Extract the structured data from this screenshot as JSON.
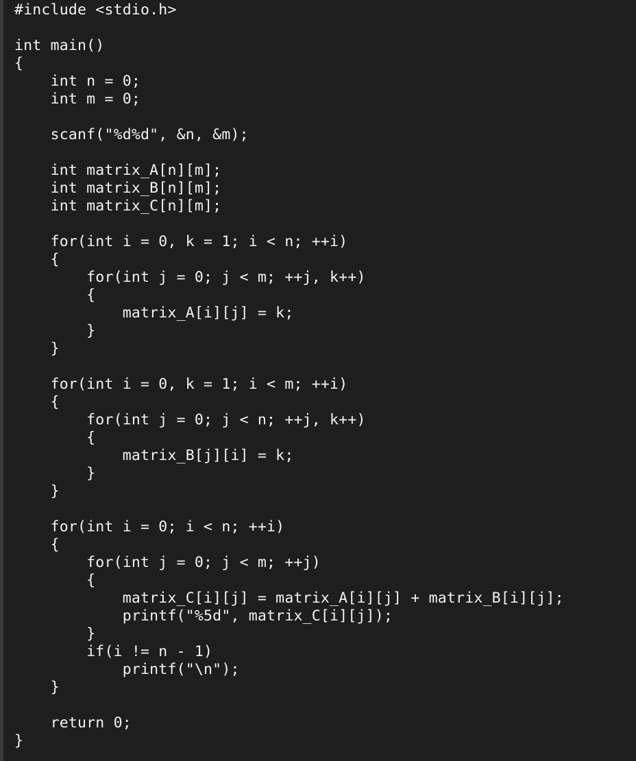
{
  "editor": {
    "lines": [
      "#include <stdio.h>",
      "",
      "int main()",
      "{",
      "    int n = 0;",
      "    int m = 0;",
      "",
      "    scanf(\"%d%d\", &n, &m);",
      "",
      "    int matrix_A[n][m];",
      "    int matrix_B[n][m];",
      "    int matrix_C[n][m];",
      "",
      "    for(int i = 0, k = 1; i < n; ++i)",
      "    {",
      "        for(int j = 0; j < m; ++j, k++)",
      "        {",
      "            matrix_A[i][j] = k;",
      "        }",
      "    }",
      "",
      "    for(int i = 0, k = 1; i < m; ++i)",
      "    {",
      "        for(int j = 0; j < n; ++j, k++)",
      "        {",
      "            matrix_B[j][i] = k;",
      "        }",
      "    }",
      "",
      "    for(int i = 0; i < n; ++i)",
      "    {",
      "        for(int j = 0; j < m; ++j)",
      "        {",
      "            matrix_C[i][j] = matrix_A[i][j] + matrix_B[i][j];",
      "            printf(\"%5d\", matrix_C[i][j]);",
      "        }",
      "        if(i != n - 1)",
      "            printf(\"\\n\");",
      "    }",
      "",
      "    return 0;",
      "}"
    ]
  },
  "colors": {
    "background": "#1e1e1e",
    "text": "#f2f2f2",
    "gutter": "#3a3a3a"
  }
}
